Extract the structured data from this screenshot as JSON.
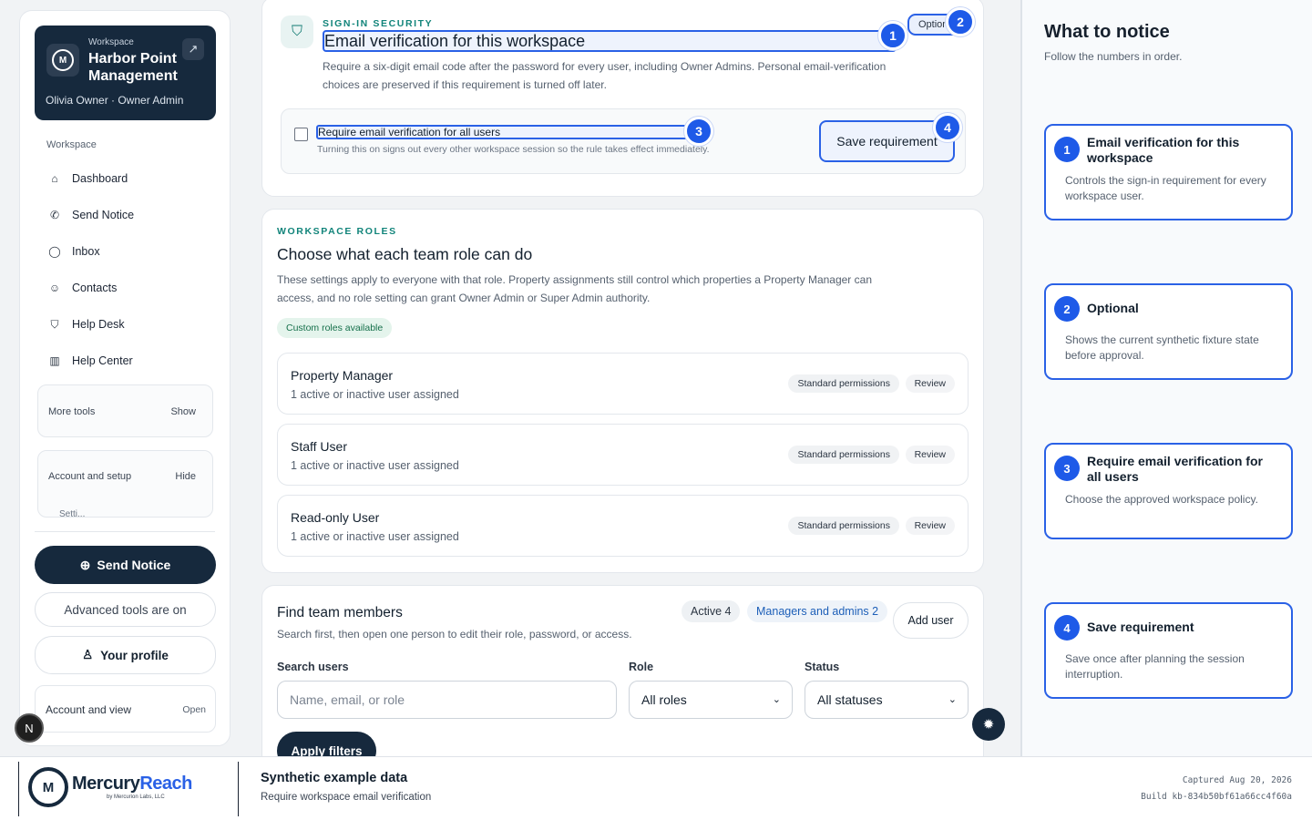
{
  "sidebar": {
    "workspace_kicker": "Workspace",
    "workspace_name": "Harbor Point Management",
    "workspace_user": "Olivia Owner · Owner Admin",
    "section_label": "Workspace",
    "nav": [
      {
        "label": "Dashboard",
        "icon": "home-icon"
      },
      {
        "label": "Send Notice",
        "icon": "megaphone-icon"
      },
      {
        "label": "Inbox",
        "icon": "chat-icon"
      },
      {
        "label": "Contacts",
        "icon": "users-icon"
      },
      {
        "label": "Help Desk",
        "icon": "shield-icon"
      },
      {
        "label": "Help Center",
        "icon": "book-icon"
      }
    ],
    "more_tools": {
      "label": "More tools",
      "action": "Show"
    },
    "account_setup": {
      "label": "Account and setup",
      "action": "Hide",
      "peek": "Setti..."
    },
    "send_notice_button": "Send Notice",
    "advanced_tools": "Advanced tools are on",
    "your_profile": "Your profile",
    "account_view": {
      "label": "Account and view",
      "action": "Open"
    },
    "n_badge": "N"
  },
  "security": {
    "kicker": "SIGN-IN SECURITY",
    "title": "Email verification for this workspace",
    "description": "Require a six-digit email code after the password for every user, including Owner Admins. Personal email-verification choices are preserved if this requirement is turned off later.",
    "optional_chip": "Optional",
    "checkbox_label": "Require email verification for all users",
    "checkbox_checked": false,
    "checkbox_hint": "Turning this on signs out every other workspace session so the rule takes effect immediately.",
    "save_button": "Save requirement"
  },
  "markers": [
    "1",
    "2",
    "3",
    "4"
  ],
  "roles": {
    "kicker": "WORKSPACE ROLES",
    "title": "Choose what each team role can do",
    "description": "These settings apply to everyone with that role. Property assignments still control which properties a Property Manager can access, and no role setting can grant Owner Admin or Super Admin authority.",
    "custom_chip": "Custom roles available",
    "items": [
      {
        "name": "Property Manager",
        "sub": "1 active or inactive user assigned",
        "perm": "Standard permissions",
        "action": "Review"
      },
      {
        "name": "Staff User",
        "sub": "1 active or inactive user assigned",
        "perm": "Standard permissions",
        "action": "Review"
      },
      {
        "name": "Read-only User",
        "sub": "1 active or inactive user assigned",
        "perm": "Standard permissions",
        "action": "Review"
      }
    ]
  },
  "members": {
    "title": "Find team members",
    "description": "Search first, then open one person to edit their role, password, or access.",
    "active_chip": "Active 4",
    "managers_chip": "Managers and admins 2",
    "add_user": "Add user",
    "search_label": "Search users",
    "search_placeholder": "Name, email, or role",
    "role_label": "Role",
    "role_value": "All roles",
    "status_label": "Status",
    "status_value": "All statuses",
    "apply": "Apply filters"
  },
  "guide": {
    "title": "What to notice",
    "subtitle": "Follow the numbers in order.",
    "cards": [
      {
        "num": "1",
        "title": "Email verification for this workspace",
        "desc": "Controls the sign-in requirement for every workspace user."
      },
      {
        "num": "2",
        "title": "Optional",
        "desc": "Shows the current synthetic fixture state before approval."
      },
      {
        "num": "3",
        "title": "Require email verification for all users",
        "desc": "Choose the approved workspace policy."
      },
      {
        "num": "4",
        "title": "Save requirement",
        "desc": "Save once after planning the session interruption."
      }
    ]
  },
  "footer": {
    "brand_a": "Mercury",
    "brand_b": "Reach",
    "brand_by": "by Mercurion Labs, LLC",
    "heading": "Synthetic example data",
    "subheading": "Require workspace email verification",
    "captured": "Captured Aug 20, 2026",
    "build": "Build kb-834b50bf61a66cc4f60a"
  },
  "colors": {
    "accent": "#2a61e6",
    "navy": "#16293d",
    "teal": "#11847a"
  }
}
